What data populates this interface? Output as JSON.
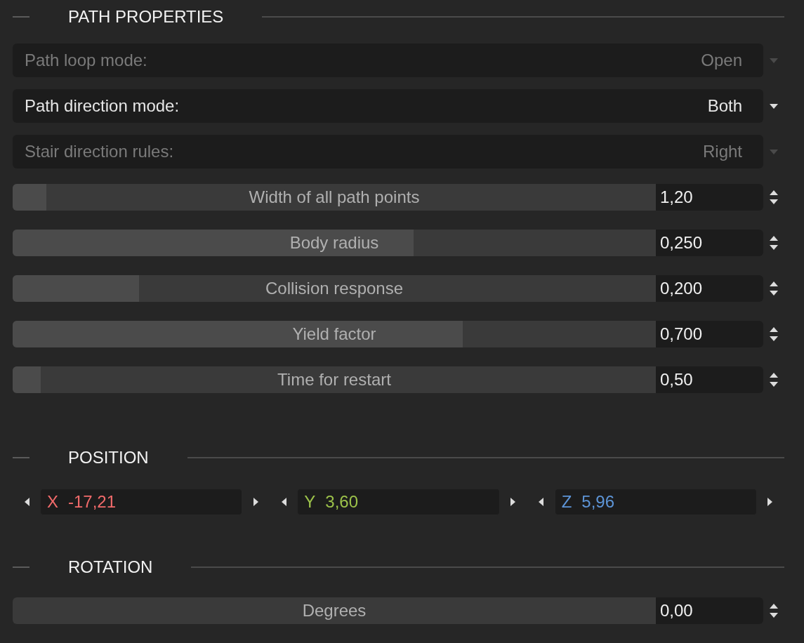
{
  "sections": [
    {
      "title": "PATH PROPERTIES",
      "rows": [
        {
          "kind": "dropdown",
          "label": "Path loop mode:",
          "value": "Open",
          "disabled": true
        },
        {
          "kind": "dropdown",
          "label": "Path direction mode:",
          "value": "Both",
          "disabled": false
        },
        {
          "kind": "dropdown",
          "label": "Stair direction rules:",
          "value": "Right",
          "disabled": true
        },
        {
          "kind": "slider",
          "label": "Width of all path points",
          "value": "1,20",
          "level": 0.052
        },
        {
          "kind": "slider",
          "label": "Body radius",
          "value": "0,250",
          "level": 0.623
        },
        {
          "kind": "slider",
          "label": "Collision response",
          "value": "0,200",
          "level": 0.197
        },
        {
          "kind": "slider",
          "label": "Yield factor",
          "value": "0,700",
          "level": 0.7
        },
        {
          "kind": "slider",
          "label": "Time for restart",
          "value": "0,50",
          "level": 0.044
        }
      ]
    },
    {
      "title": "POSITION",
      "rows": [
        {
          "kind": "vector",
          "axes": [
            {
              "axis": "X",
              "value": "-17,21",
              "color": "#f26b6b"
            },
            {
              "axis": "Y",
              "value": "3,60",
              "color": "#9cc24a"
            },
            {
              "axis": "Z",
              "value": "5,96",
              "color": "#5d94d6"
            }
          ]
        }
      ]
    },
    {
      "title": "ROTATION",
      "rows": [
        {
          "kind": "slider",
          "label": "Degrees",
          "value": "0,00"
        }
      ]
    }
  ]
}
